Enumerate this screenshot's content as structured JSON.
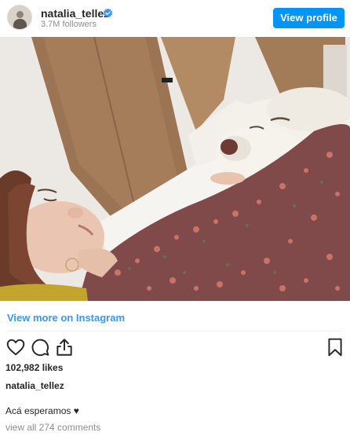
{
  "header": {
    "username": "natalia_tellez",
    "followers": "3.7M followers",
    "view_profile_label": "View profile"
  },
  "post": {
    "view_more_label": "View more on Instagram",
    "likes": "102,982 likes",
    "caption_username": "natalia_tellez",
    "caption_text": "Acá esperamos ♥",
    "comments_link": "view all 274 comments"
  },
  "icons": {
    "like": "heart-icon",
    "comment": "comment-icon",
    "share": "share-icon",
    "save": "bookmark-icon",
    "verified": "verified-badge-icon"
  },
  "colors": {
    "accent": "#0095f6",
    "link": "#3897f0",
    "text": "#262626",
    "muted": "#8e8e8e"
  }
}
